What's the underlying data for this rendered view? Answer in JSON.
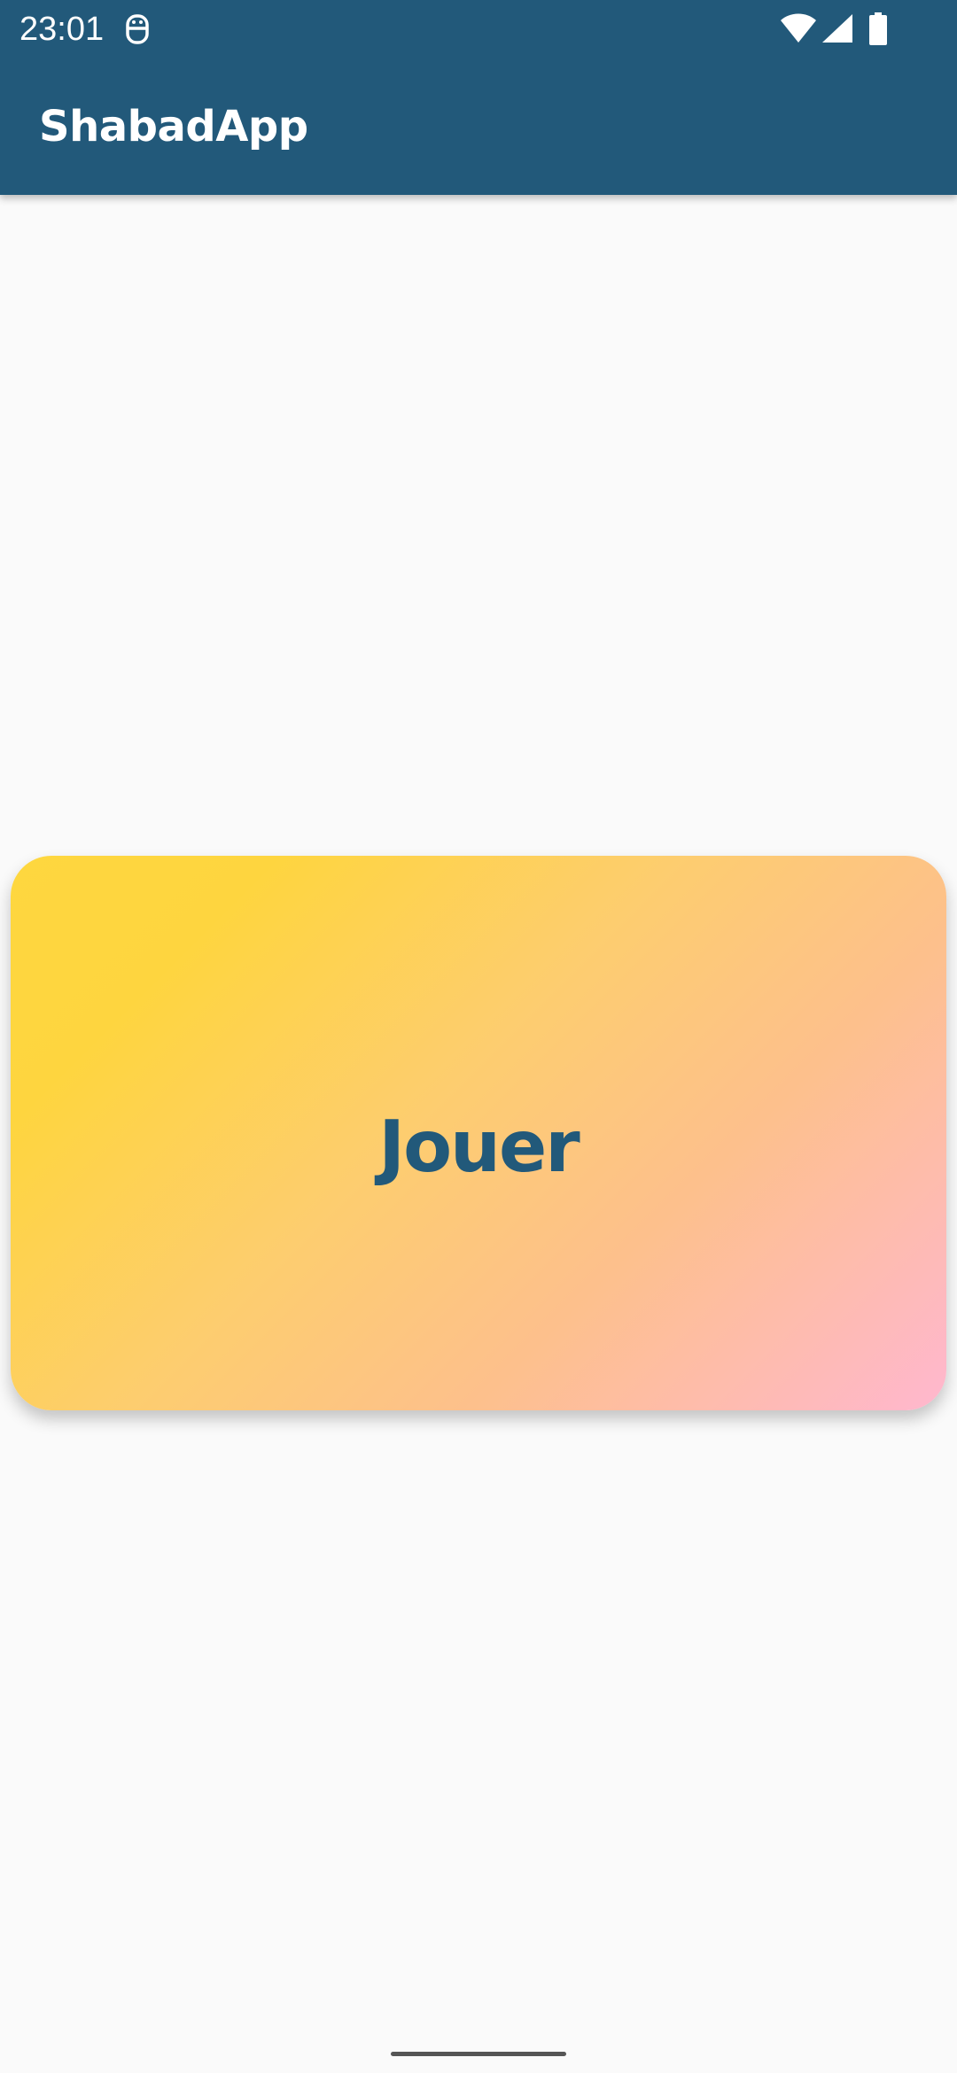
{
  "status_bar": {
    "time": "23:01",
    "icons": [
      "app-notification-icon",
      "wifi-icon",
      "cellular-signal-icon",
      "battery-icon"
    ]
  },
  "app_bar": {
    "title": "ShabadApp"
  },
  "main": {
    "play_button_label": "Jouer"
  },
  "colors": {
    "app_bar": "#22597A",
    "background": "#FAFAFA",
    "card_gradient_start": "#FED73F",
    "card_gradient_mid": "#FDCD6F",
    "card_gradient_end": "#FFB7CF",
    "label_text": "#22597A"
  }
}
